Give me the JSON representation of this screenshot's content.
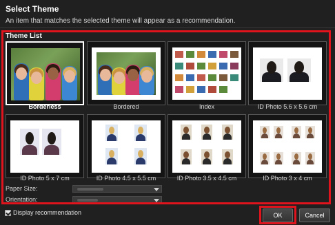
{
  "dialog": {
    "title": "Select Theme",
    "subtitle": "An item that matches the selected theme will appear as a recommendation."
  },
  "theme_list": {
    "label": "Theme List",
    "items": [
      {
        "label": "Borderless",
        "selected": true
      },
      {
        "label": "Bordered",
        "selected": false
      },
      {
        "label": "Index",
        "selected": false
      },
      {
        "label": "ID Photo 5.6 x 5.6 cm",
        "selected": false
      },
      {
        "label": "ID Photo 5 x 7 cm",
        "selected": false
      },
      {
        "label": "ID Photo 4.5 x 5.5 cm",
        "selected": false
      },
      {
        "label": "ID Photo 3.5 x 4.5 cm",
        "selected": false
      },
      {
        "label": "ID Photo 3 x 4 cm",
        "selected": false
      }
    ]
  },
  "paper": {
    "size_label": "Paper Size:",
    "orientation_label": "Orientation:"
  },
  "footer": {
    "display_recommendation_label": "Display recommendation",
    "display_recommendation_checked": true,
    "ok_label": "OK",
    "cancel_label": "Cancel"
  },
  "colors": {
    "highlight": "#e0141c",
    "background": "#202020"
  }
}
